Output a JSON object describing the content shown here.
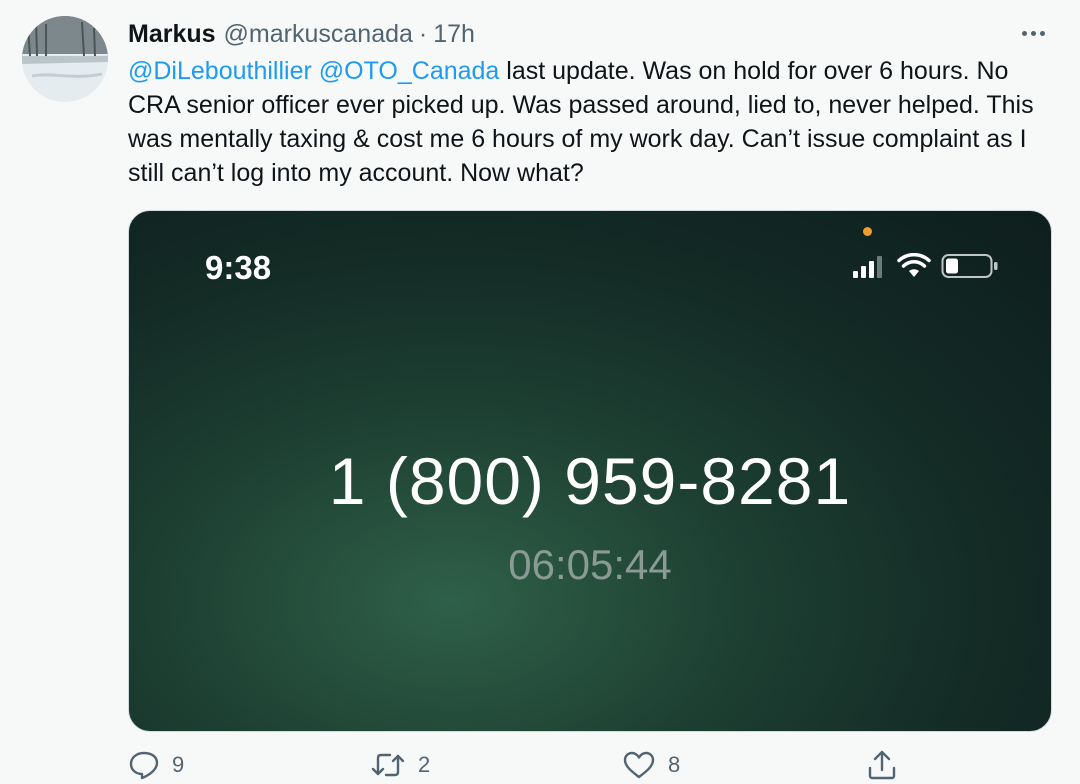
{
  "tweet": {
    "display_name": "Markus",
    "handle": "@markuscanada",
    "separator": "·",
    "time": "17h",
    "text": {
      "mention_1": "@DiLebouthillier",
      "mention_2": "@OTO_Canada",
      "body": " last update. Was on hold for over 6 hours. No CRA senior officer ever picked up. Was passed around, lied to, never helped. This was mentally taxing & cost me 6 hours of my work day. Can’t issue complaint as I still can’t log into my account. Now what?"
    }
  },
  "media": {
    "status_time": "9:38",
    "phone_number": "1 (800) 959-8281",
    "call_timer": "06:05:44",
    "icons": [
      "cellular-signal-icon",
      "wifi-icon",
      "battery-icon"
    ]
  },
  "actions": {
    "reply_count": "9",
    "retweet_count": "2",
    "like_count": "8"
  },
  "colors": {
    "mention": "#1d9bf0",
    "secondary_text": "#536471",
    "background": "#f7f9f9"
  }
}
